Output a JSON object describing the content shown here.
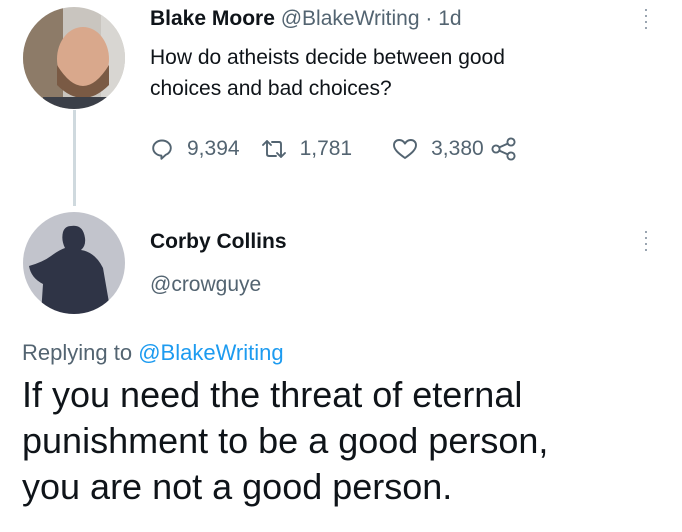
{
  "tweet": {
    "author": {
      "name": "Blake Moore",
      "handle": "@BlakeWriting",
      "time": "· 1d"
    },
    "text_lines": [
      "How do atheists decide between good",
      "choices and bad choices?"
    ],
    "stats": {
      "replies": "9,394",
      "retweets": "1,781",
      "likes": "3,380"
    },
    "more_icon": "vertical-ellipsis-icon"
  },
  "reply": {
    "author": {
      "name": "Corby Collins",
      "handle": "@crowguye"
    },
    "replying_prefix": "Replying to",
    "replying_to": "@BlakeWriting",
    "text_lines": [
      "If you need the threat of eternal",
      "punishment to be a good person,",
      "you are not a good person."
    ]
  },
  "colors": {
    "text": "#0f1419",
    "muted": "#536471",
    "link": "#1d9bf0",
    "thread": "#cfd9de"
  }
}
